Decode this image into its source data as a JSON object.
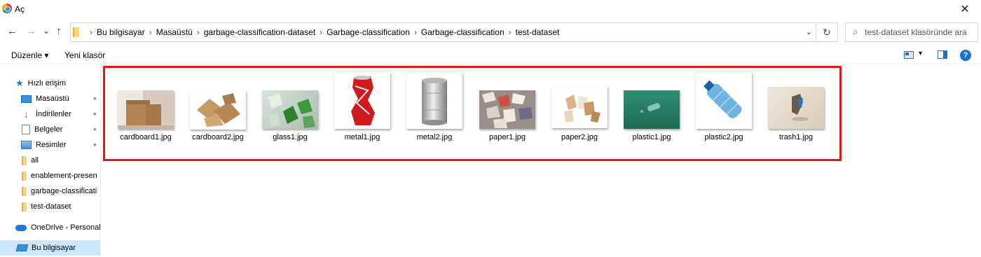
{
  "window": {
    "title": "Aç",
    "close_glyph": "✕",
    "app_icon": "chrome-icon"
  },
  "nav": {
    "back": "←",
    "forward": "→",
    "recent": "⌄",
    "up": "↑"
  },
  "address": {
    "crumbs": [
      "Bu bilgisayar",
      "Masaüstü",
      "garbage-classification-dataset",
      "Garbage-classification",
      "Garbage-classification",
      "test-dataset"
    ],
    "separator": "›",
    "dropdown_glyph": "⌄",
    "refresh_glyph": "↻"
  },
  "search": {
    "placeholder": "test-dataset klasöründe ara",
    "icon_glyph": "⌕"
  },
  "toolbar": {
    "organize_label": "Düzenle ▾",
    "new_folder_label": "Yeni klasör",
    "view_glyph": "▾",
    "help_label": "?"
  },
  "sidebar": {
    "items": [
      {
        "label": "Hızlı erişim",
        "icon": "star-icon"
      },
      {
        "label": "Masaüstü",
        "icon": "desktop-icon",
        "pinned": true
      },
      {
        "label": "İndirilenler",
        "icon": "download-icon",
        "pinned": true
      },
      {
        "label": "Belgeler",
        "icon": "documents-icon",
        "pinned": true
      },
      {
        "label": "Resimler",
        "icon": "pictures-icon",
        "pinned": true
      },
      {
        "label": "all",
        "icon": "folder-icon"
      },
      {
        "label": "enablement-presen",
        "icon": "folder-icon"
      },
      {
        "label": "garbage-classificati",
        "icon": "folder-icon"
      },
      {
        "label": "test-dataset",
        "icon": "folder-icon"
      },
      {
        "label": "OneDrive - Personal",
        "icon": "cloud-icon"
      },
      {
        "label": "Bu bilgisayar",
        "icon": "computer-icon",
        "selected": true
      }
    ],
    "pin_glyph": "📌"
  },
  "files": [
    {
      "name": "cardboard1.jpg",
      "subject": "cardboard box"
    },
    {
      "name": "cardboard2.jpg",
      "subject": "cardboard pieces"
    },
    {
      "name": "glass1.jpg",
      "subject": "broken glass"
    },
    {
      "name": "metal1.jpg",
      "subject": "crushed red can"
    },
    {
      "name": "metal2.jpg",
      "subject": "tin can"
    },
    {
      "name": "paper1.jpg",
      "subject": "paper scraps"
    },
    {
      "name": "paper2.jpg",
      "subject": "paper pieces"
    },
    {
      "name": "plastic1.jpg",
      "subject": "bottle underwater"
    },
    {
      "name": "plastic2.jpg",
      "subject": "plastic bottle"
    },
    {
      "name": "trash1.jpg",
      "subject": "trash item"
    }
  ],
  "colors": {
    "highlight": "#e5171c",
    "selection": "#cce8ff",
    "accent": "#1e78d7"
  }
}
